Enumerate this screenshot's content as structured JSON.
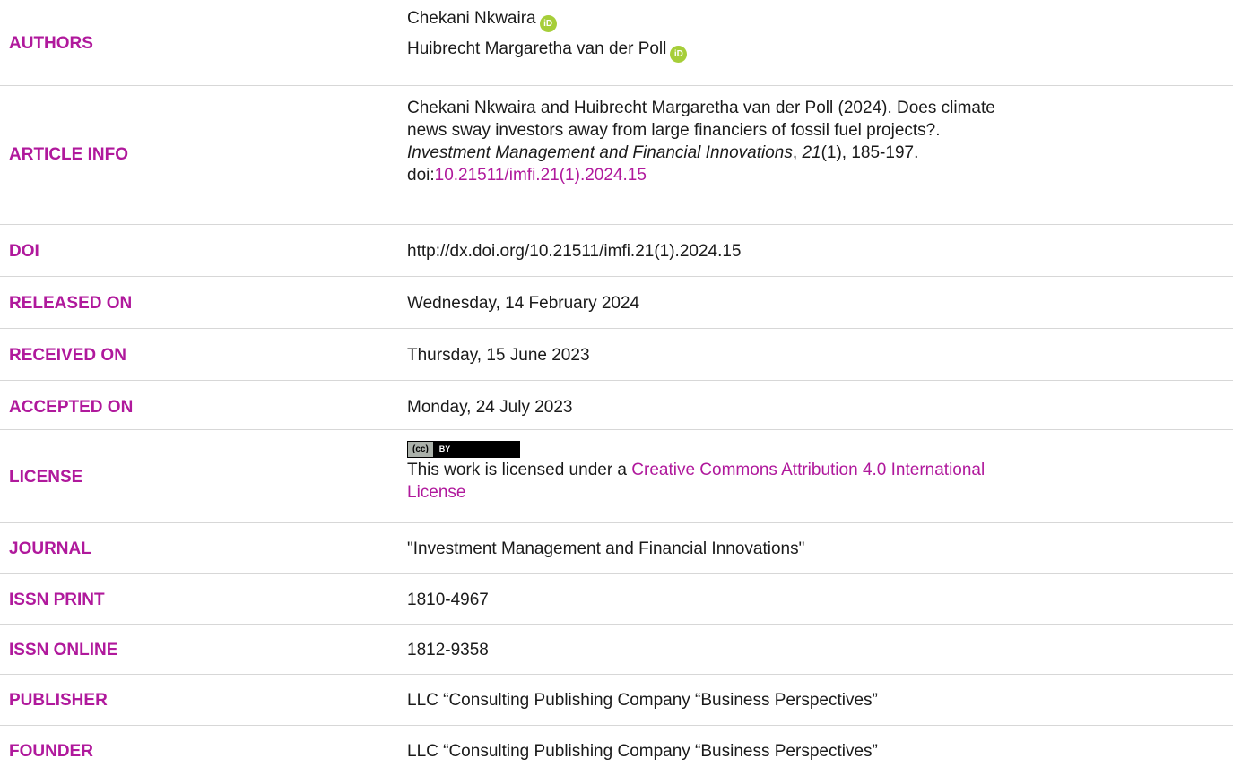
{
  "labels": {
    "authors": "AUTHORS",
    "article_info": "ARTICLE INFO",
    "doi": "DOI",
    "released_on": "RELEASED ON",
    "received_on": "RECEIVED ON",
    "accepted_on": "ACCEPTED ON",
    "license": "LICENSE",
    "journal": "JOURNAL",
    "issn_print": "ISSN PRINT",
    "issn_online": "ISSN ONLINE",
    "publisher": "PUBLISHER",
    "founder": "FOUNDER"
  },
  "authors": [
    "Chekani Nkwaira",
    "Huibrecht Margaretha van der Poll"
  ],
  "orcid_icon_text": "iD",
  "article_info": {
    "line1": "Chekani Nkwaira and Huibrecht Margaretha van der Poll (2024). Does climate",
    "line2": "news sway investors away from large financiers of fossil fuel projects?.",
    "journal_italic": "Investment Management and Financial Innovations",
    "sep1": ", ",
    "volume_italic": "21",
    "rest": "(1), 185-197.",
    "doi_prefix": "doi:",
    "doi_link": "10.21511/imfi.21(1).2024.15"
  },
  "doi": "http://dx.doi.org/10.21511/imfi.21(1).2024.15",
  "released_on": "Wednesday, 14 February 2024",
  "received_on": "Thursday, 15 June 2023",
  "accepted_on": "Monday, 24 July 2023",
  "license": {
    "badge_cc": "(cc)",
    "badge_by": "BY",
    "text_prefix": "This work is licensed under a ",
    "link_line1": "Creative Commons Attribution 4.0 International",
    "link_line2": "License"
  },
  "journal": "\"Investment Management and Financial Innovations\"",
  "issn_print": "1810-4967",
  "issn_online": "1812-9358",
  "publisher": "LLC “Consulting Publishing Company “Business Perspectives”",
  "founder": "LLC “Consulting Publishing Company “Business Perspectives”",
  "colors": {
    "accent": "#b0199c",
    "text": "#1a1a1a",
    "divider": "#d7d7d7",
    "orcid": "#a6ce39"
  }
}
